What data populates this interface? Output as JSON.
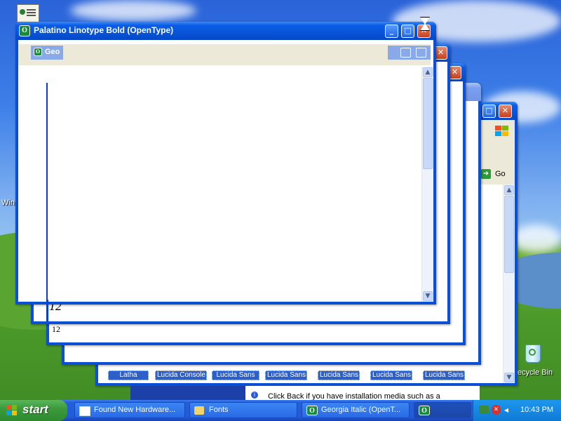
{
  "windows": {
    "front": {
      "title": "Palatino Linotype Bold (OpenType)",
      "icon_letter": "O"
    },
    "second": {
      "title": "Geo",
      "icon_letter": "O"
    },
    "explorer": {
      "go_label": "Go",
      "info_text": "Click Back if you have installation media such as a"
    }
  },
  "preview_text": {
    "large": "12",
    "small": "12"
  },
  "font_tiles": [
    "Latha",
    "Lucida Console",
    "Lucida Sans",
    "Lucida Sans",
    "Lucida Sans",
    "Lucida Sans",
    "Lucida Sans"
  ],
  "desktop": {
    "recycle_bin_label": "ecycle Bin",
    "left_label": "Win"
  },
  "taskbar": {
    "start_label": "start",
    "tasks": [
      {
        "label": "Found New Hardware..."
      },
      {
        "label": "Fonts"
      },
      {
        "label": "Georgia Italic (OpenT..."
      },
      {
        "label": ""
      }
    ],
    "clock": "10:43 PM"
  },
  "colors": {
    "title_active": "#0854d8",
    "taskbar": "#245edb",
    "start": "#3c9a3c",
    "tray": "#1d96ee"
  }
}
